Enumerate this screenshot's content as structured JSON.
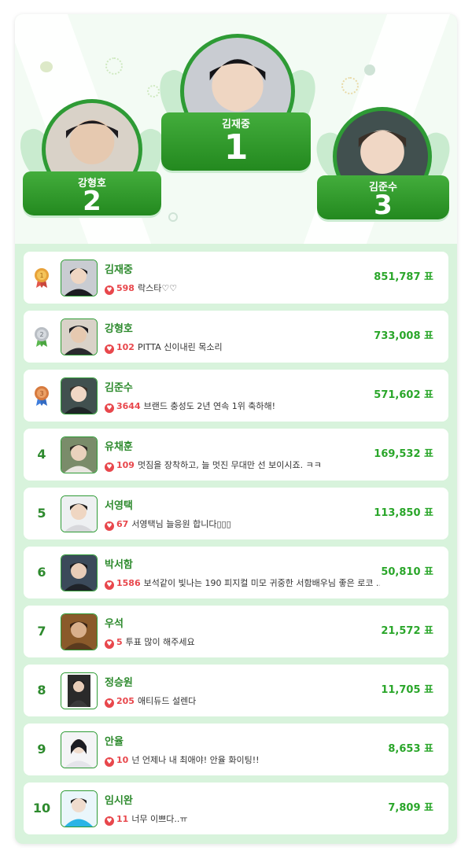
{
  "podium": [
    {
      "rank": "1",
      "name": "김재중"
    },
    {
      "rank": "2",
      "name": "강형호"
    },
    {
      "rank": "3",
      "name": "김준수"
    }
  ],
  "rows": [
    {
      "rank": "1",
      "name": "김재중",
      "count": "598",
      "msg": "락스타♡♡",
      "votes": "851,787 표"
    },
    {
      "rank": "2",
      "name": "강형호",
      "count": "102",
      "msg": "PITTA 신이내린 목소리",
      "votes": "733,008 표"
    },
    {
      "rank": "3",
      "name": "김준수",
      "count": "3644",
      "msg": "브랜드 충성도 2년 연속 1위 축하해!",
      "votes": "571,602 표"
    },
    {
      "rank": "4",
      "name": "유채훈",
      "count": "109",
      "msg": "멋짐을 장착하고, 늘 멋진 무대만 선 보이시죠. ㅋㅋ",
      "votes": "169,532 표"
    },
    {
      "rank": "5",
      "name": "서영택",
      "count": "67",
      "msg": "서영택님 늘응원 합니다▯▯▯",
      "votes": "113,850 표"
    },
    {
      "rank": "6",
      "name": "박서함",
      "count": "1586",
      "msg": "보석같이 빛나는 190 피지컬 미모 귀중한 서함배우님 좋은 로코 ...",
      "votes": "50,810 표"
    },
    {
      "rank": "7",
      "name": "우석",
      "count": "5",
      "msg": "투표 많이 해주세요",
      "votes": "21,572 표"
    },
    {
      "rank": "8",
      "name": "정승원",
      "count": "205",
      "msg": "애티듀드 설렌다",
      "votes": "11,705 표"
    },
    {
      "rank": "9",
      "name": "안율",
      "count": "10",
      "msg": "넌 언제나 내 최애야! 안율 화이팅!!",
      "votes": "8,653 표"
    },
    {
      "rank": "10",
      "name": "임시완",
      "count": "11",
      "msg": "너무 이쁘다..ㅠ",
      "votes": "7,809 표"
    }
  ],
  "icons": {
    "heart": "heart-icon",
    "medal": "medal-icon"
  },
  "colors": {
    "primary": "#2e9b35",
    "vote": "#2aa62a",
    "heart": "#e8474c",
    "list_bg": "#d8f3dc",
    "gold": "#e8a23a",
    "silver": "#b9bec4",
    "bronze": "#d77a3e"
  }
}
